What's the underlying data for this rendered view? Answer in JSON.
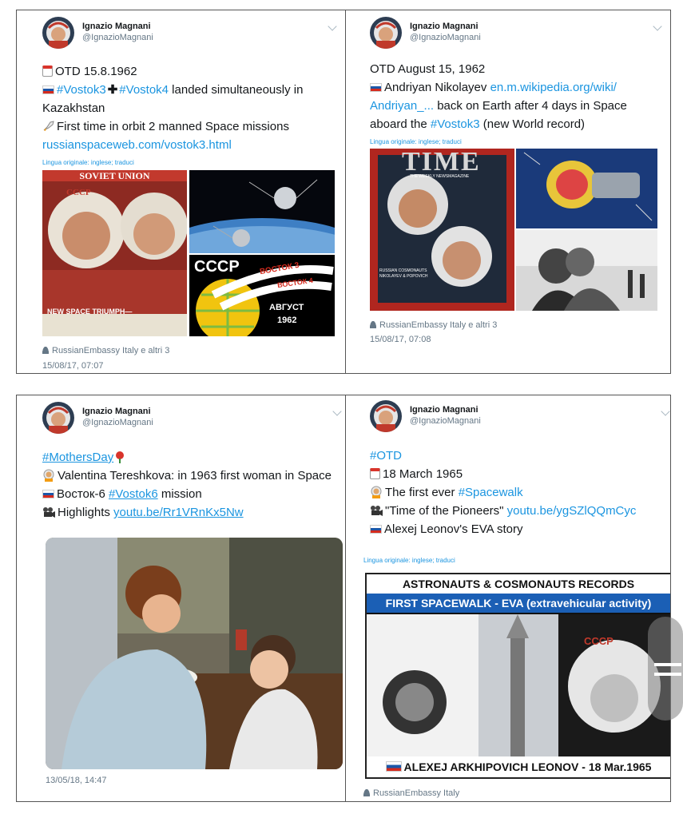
{
  "tweets": [
    {
      "user": "Ignazio Magnani",
      "handle": "@IgnazioMagnani",
      "lines": {
        "l1": "OTD 15.8.1962",
        "tag1": "#Vostok3",
        "tag2": "#Vostok4",
        "l2_rest": " landed simultaneously in",
        "l3": "Kazakhstan",
        "l4": "First time in orbit 2 manned Space missions",
        "link": "russianspaceweb.com/vostok3.html"
      },
      "lang": "Lingua originale: inglese; traduci",
      "images": {
        "magazine_title": "SOVIET UNION",
        "magazine_cccp": "CCCP",
        "magazine_caption": "NEW SPACE TRIUMPH—",
        "logo_cccp": "CCCP",
        "logo_v3": "ВОСТОК 3",
        "logo_v4": "ВОСТОК 4",
        "logo_month": "АВГУСТ",
        "logo_year": "1962"
      },
      "retweeters": "RussianEmbassy Italy e altri 3",
      "time": "15/08/17, 07:07"
    },
    {
      "user": "Ignazio Magnani",
      "handle": "@IgnazioMagnani",
      "lines": {
        "l1": "OTD August 15, 1962",
        "l2a": "Andriyan Nikolayev ",
        "link1": "en.m.wikipedia.org/wiki/",
        "link2": "Andriyan_...",
        "l3_rest": " back on Earth after 4 days in Space",
        "l4a": "aboard the ",
        "tag": "#Vostok3",
        "l4b": " (new World record)"
      },
      "lang": "Lingua originale: inglese; traduci",
      "images": {
        "time_title": "TIME",
        "time_sub": "THE WEEKLY NEWSMAGAZINE",
        "time_caption": "RUSSIAN COSMONAUTS NIKOLAYEV & POPOVICH"
      },
      "retweeters": "RussianEmbassy Italy e altri 3",
      "time": "15/08/17, 07:08"
    },
    {
      "user": "Ignazio Magnani",
      "handle": "@IgnazioMagnani",
      "lines": {
        "tag1": "#MothersDay",
        "l2": "Valentina Tereshkova: in 1963 first woman in Space",
        "l3a": "Восток-6 ",
        "tag2": "#Vostok6",
        "l3b": " mission",
        "l4a": "Highlights ",
        "link": "youtu.be/Rr1VRnKx5Nw"
      },
      "time": "13/05/18, 14:47"
    },
    {
      "user": "Ignazio Magnani",
      "handle": "@IgnazioMagnani",
      "lines": {
        "tag1": "#OTD",
        "l2": "18 March 1965",
        "l3a": "The first ever ",
        "tag2": "#Spacewalk",
        "l4a": "\"Time of the Pioneers\" ",
        "link": "youtu.be/ygSZlQQmCyc",
        "l5": "Alexej Leonov's EVA story"
      },
      "lang": "Lingua originale: inglese; traduci",
      "images": {
        "banner1": "ASTRONAUTS & COSMONAUTS RECORDS",
        "banner2": "FIRST SPACEWALK - EVA (extravehicular activity)",
        "footer": "ALEXEJ ARKHIPOVICH LEONOV - 18 Mar.1965",
        "helmet": "CCCP"
      },
      "retweeters": "RussianEmbassy Italy"
    }
  ],
  "colors": {
    "link": "#1b95e0",
    "meta": "#657786",
    "text": "#14171a"
  }
}
